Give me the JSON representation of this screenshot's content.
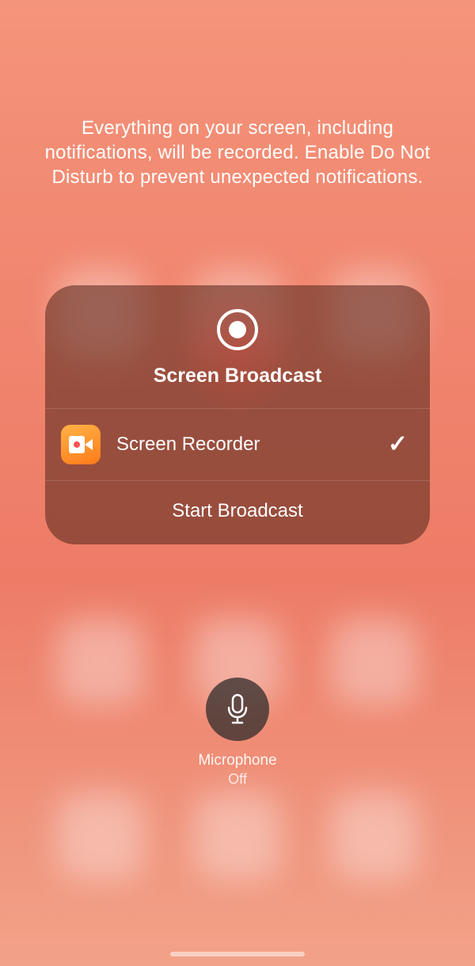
{
  "info_text": "Everything on your screen, including notifications, will be recorded. Enable Do Not Disturb to prevent unexpected notifications.",
  "panel": {
    "title": "Screen Broadcast",
    "app": {
      "label": "Screen Recorder",
      "selected": true
    },
    "start_label": "Start Broadcast"
  },
  "microphone": {
    "label": "Microphone",
    "status": "Off"
  }
}
